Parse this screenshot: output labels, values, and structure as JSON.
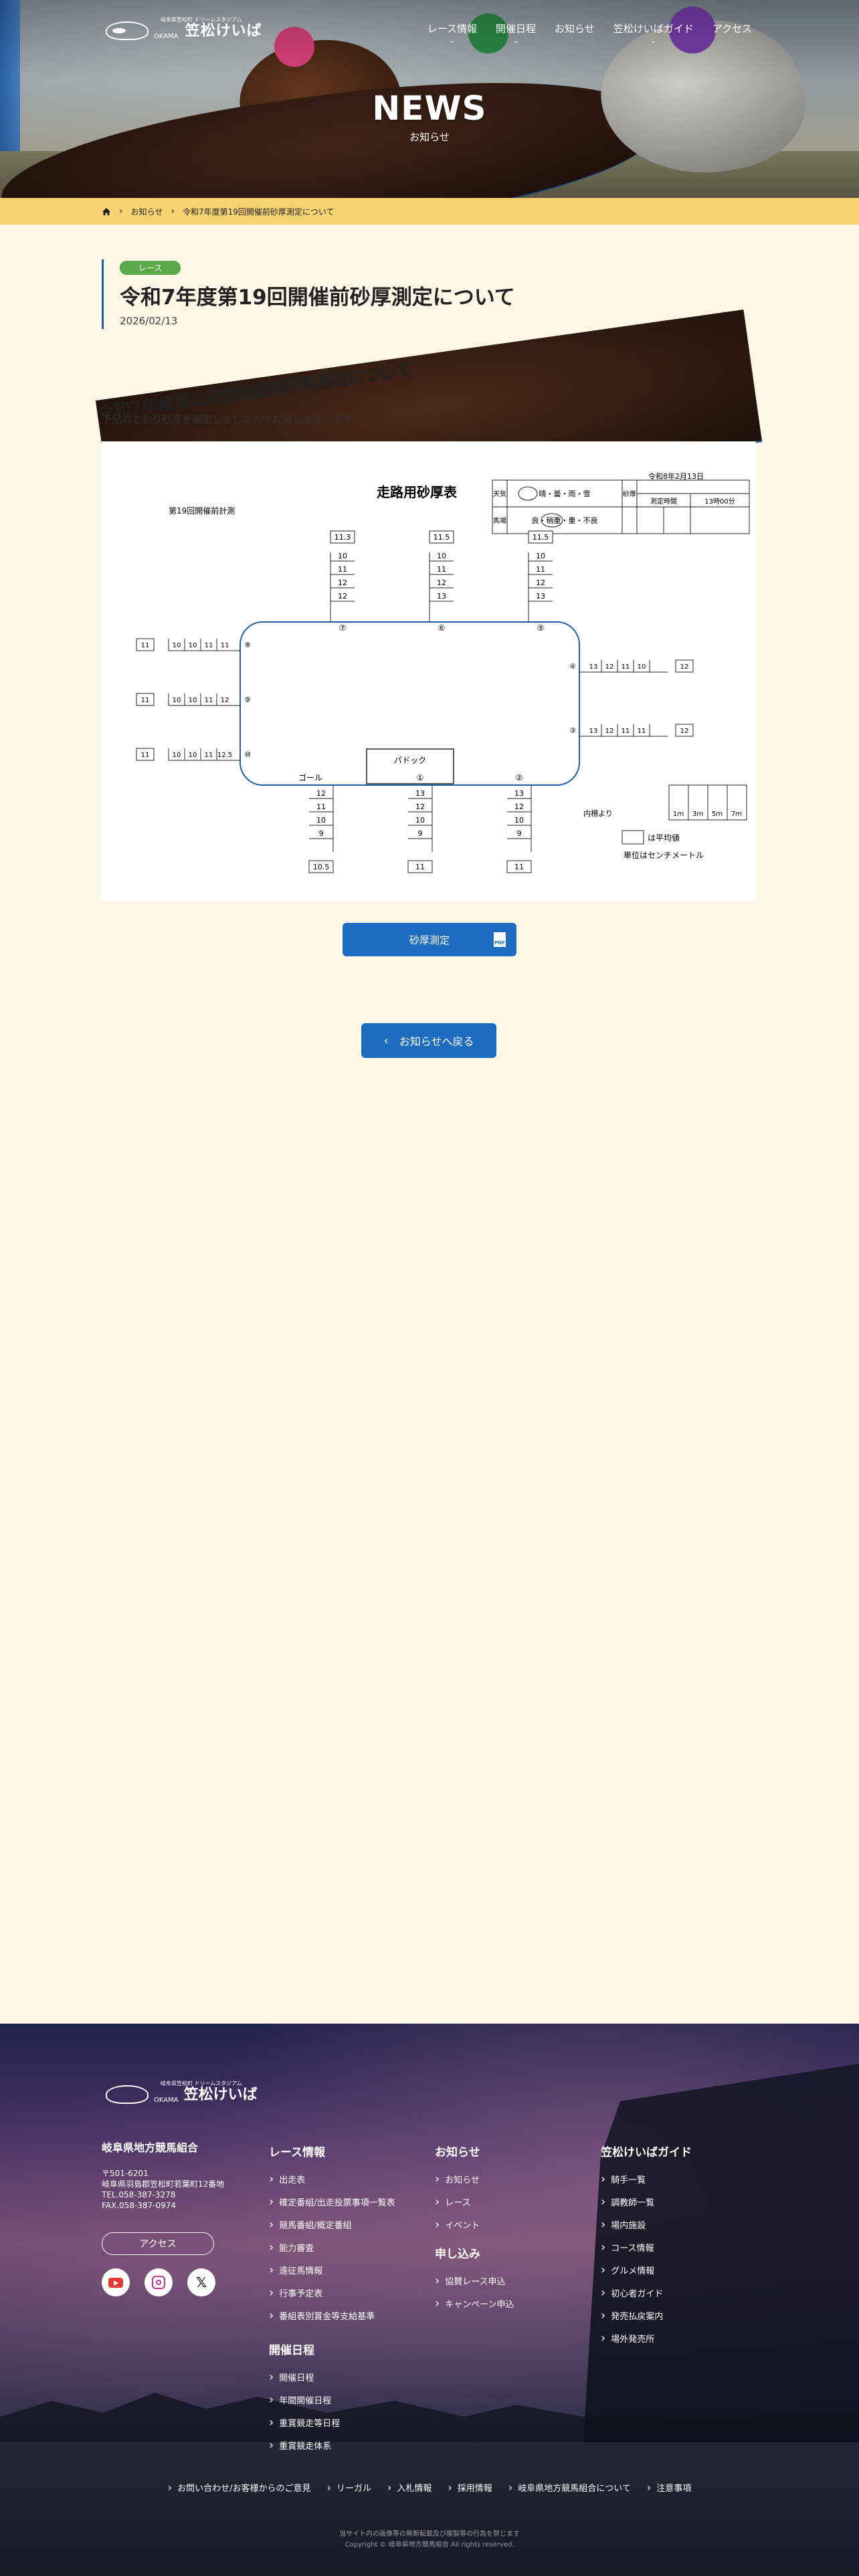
{
  "header": {
    "logo_small": "岐阜県笠松町 ドリームスタジアム",
    "logo_sub": "OKAMA",
    "logo_text": "笠松けいば",
    "nav": [
      "レース情報",
      "開催日程",
      "お知らせ",
      "笠松けいばガイド",
      "アクセス"
    ],
    "nav_has_dropdown": [
      true,
      true,
      false,
      true,
      false
    ],
    "hero_title": "NEWS",
    "hero_subtitle": "お知らせ"
  },
  "breadcrumb": [
    "お知らせ",
    "令和7年度第19回開催前砂厚測定について"
  ],
  "article": {
    "tag": "レース",
    "title": "令和7年度第19回開催前砂厚測定について",
    "date": "2026/02/13",
    "heading": "令和7年度第19回開催前砂厚測定について",
    "lead": "下記のとおり砂厚を測定しましたのでお知らせ致します。",
    "pdf_button": "砂厚測定",
    "pdf_icon": "PDF",
    "back_button": "お知らせへ戻る"
  },
  "figure": {
    "title": "走路用砂厚表",
    "subtitle": "第19回開催前計測",
    "date": "令和8年2月13日",
    "weather_label": "天気",
    "weather": "晴・曇・雨・雪",
    "weather_selected": "晴",
    "track_label": "馬場",
    "track": "良・稍重・重・不良",
    "track_selected": "稍重",
    "sand_label": "砂厚",
    "time_label": "測定時間",
    "time": "13時00分",
    "top_points": [
      {
        "label": "⑦",
        "values": [
          "11.3",
          "10",
          "11",
          "12",
          "12"
        ]
      },
      {
        "label": "⑥",
        "values": [
          "11.5",
          "10",
          "11",
          "12",
          "13"
        ]
      },
      {
        "label": "⑤",
        "values": [
          "11.5",
          "10",
          "11",
          "12",
          "13"
        ]
      }
    ],
    "left_points": [
      {
        "label": "⑧",
        "values": [
          "11",
          "10",
          "10",
          "11",
          "11"
        ]
      },
      {
        "label": "⑨",
        "values": [
          "11",
          "10",
          "10",
          "11",
          "12"
        ]
      },
      {
        "label": "⑩",
        "values": [
          "11",
          "10",
          "10",
          "11",
          "12.5"
        ]
      }
    ],
    "right_points": [
      {
        "label": "④",
        "values": [
          "13",
          "12",
          "11",
          "10",
          "12"
        ]
      },
      {
        "label": "③",
        "values": [
          "13",
          "12",
          "11",
          "11",
          "12"
        ]
      }
    ],
    "bottom_points": [
      {
        "label": "ゴール",
        "values": [
          "12",
          "11",
          "10",
          "9",
          "10.5"
        ]
      },
      {
        "label": "①",
        "values": [
          "13",
          "12",
          "10",
          "9",
          "11"
        ]
      },
      {
        "label": "②",
        "values": [
          "13",
          "12",
          "10",
          "9",
          "11"
        ]
      }
    ],
    "paddock": "パドック",
    "rail_label": "内柵より",
    "rail_cols": [
      "1ｍ",
      "3ｍ",
      "5ｍ",
      "7ｍ"
    ],
    "legend": "は平均値",
    "unit": "単位はセンチメートル"
  },
  "footer": {
    "org_name": "岐阜県地方競馬組合",
    "address": [
      "〒501-6201",
      "岐阜県羽島郡笠松町若葉町12番地",
      "TEL.058-387-3278",
      "FAX.058-387-0974"
    ],
    "access_button": "アクセス",
    "columns": [
      {
        "title": "レース情報",
        "links": [
          "出走表",
          "確定番組/出走投票事項一覧表",
          "競馬番組/概定番組",
          "能力審査",
          "遠征馬情報",
          "行事予定表",
          "番組表別賞金等支給基準"
        ]
      },
      {
        "title": "開催日程",
        "links": [
          "開催日程",
          "年間開催日程",
          "重賞競走等日程",
          "重賞競走体系"
        ]
      },
      {
        "title": "お知らせ",
        "links": [
          "お知らせ",
          "レース",
          "イベント"
        ]
      },
      {
        "title": "申し込み",
        "links": [
          "協賛レース申込",
          "キャンペーン申込"
        ]
      },
      {
        "title": "笠松けいばガイド",
        "links": [
          "騎手一覧",
          "調教師一覧",
          "場内施設",
          "コース情報",
          "グルメ情報",
          "初心者ガイド",
          "発売払戻案内",
          "場外発売所"
        ]
      }
    ],
    "bottom_links": [
      "お問い合わせ/お客様からのご意見",
      "リーガル",
      "入札情報",
      "採用情報",
      "岐阜県地方競馬組合について",
      "注意事項"
    ],
    "notice": "当サイト内の画像等の無断転載及び複製等の行為を禁じます",
    "copyright": "Copyright © 岐阜県地方競馬組合 All rights reserved."
  }
}
